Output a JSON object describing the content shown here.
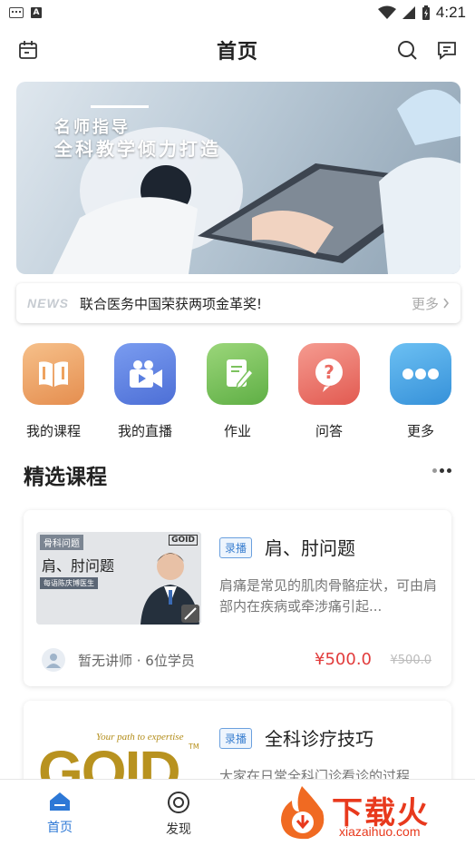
{
  "status": {
    "time": "4:21",
    "badge": "A"
  },
  "header": {
    "title": "首页"
  },
  "banner": {
    "line1": "名师指导",
    "line2": "全科教学倾力打造"
  },
  "news": {
    "tag": "NEWS",
    "text": "联合医务中国荣获两项金革奖!",
    "more": "更多"
  },
  "quick": [
    {
      "label": "我的课程",
      "icon": "book-icon",
      "color": "#eea25f"
    },
    {
      "label": "我的直播",
      "icon": "video-camera-icon",
      "color": "#5a7fe0"
    },
    {
      "label": "作业",
      "icon": "notebook-pen-icon",
      "color": "#7cc25e"
    },
    {
      "label": "问答",
      "icon": "question-icon",
      "color": "#ea6a62"
    },
    {
      "label": "更多",
      "icon": "more-dots-icon",
      "color": "#4aa6e6"
    }
  ],
  "section": {
    "title": "精选课程"
  },
  "courses": [
    {
      "badge": "录播",
      "title": "肩、肘问题",
      "desc": "肩痛是常见的肌肉骨骼症状，可由肩部内在疾病或牵涉痛引起...",
      "teacher": "暂无讲师 · 6位学员",
      "price": "¥500.0",
      "old_price": "¥500.0",
      "thumb_tag": "骨科问题",
      "thumb_title": "肩、肘问题",
      "thumb_sub": "每语陈庆博医生",
      "thumb_brand": "GOID"
    },
    {
      "badge": "录播",
      "title": "全科诊疗技巧",
      "desc": "大家在日常全科门诊看诊的过程",
      "thumb_brand": "GOID",
      "thumb_slogan": "Your path to expertise",
      "thumb_tm": "TM"
    }
  ],
  "tabs": [
    {
      "label": "首页",
      "icon": "home-icon"
    },
    {
      "label": "发现",
      "icon": "discover-icon"
    }
  ],
  "watermark": {
    "main": "下载火",
    "sub": "xiazaihuo.com"
  }
}
